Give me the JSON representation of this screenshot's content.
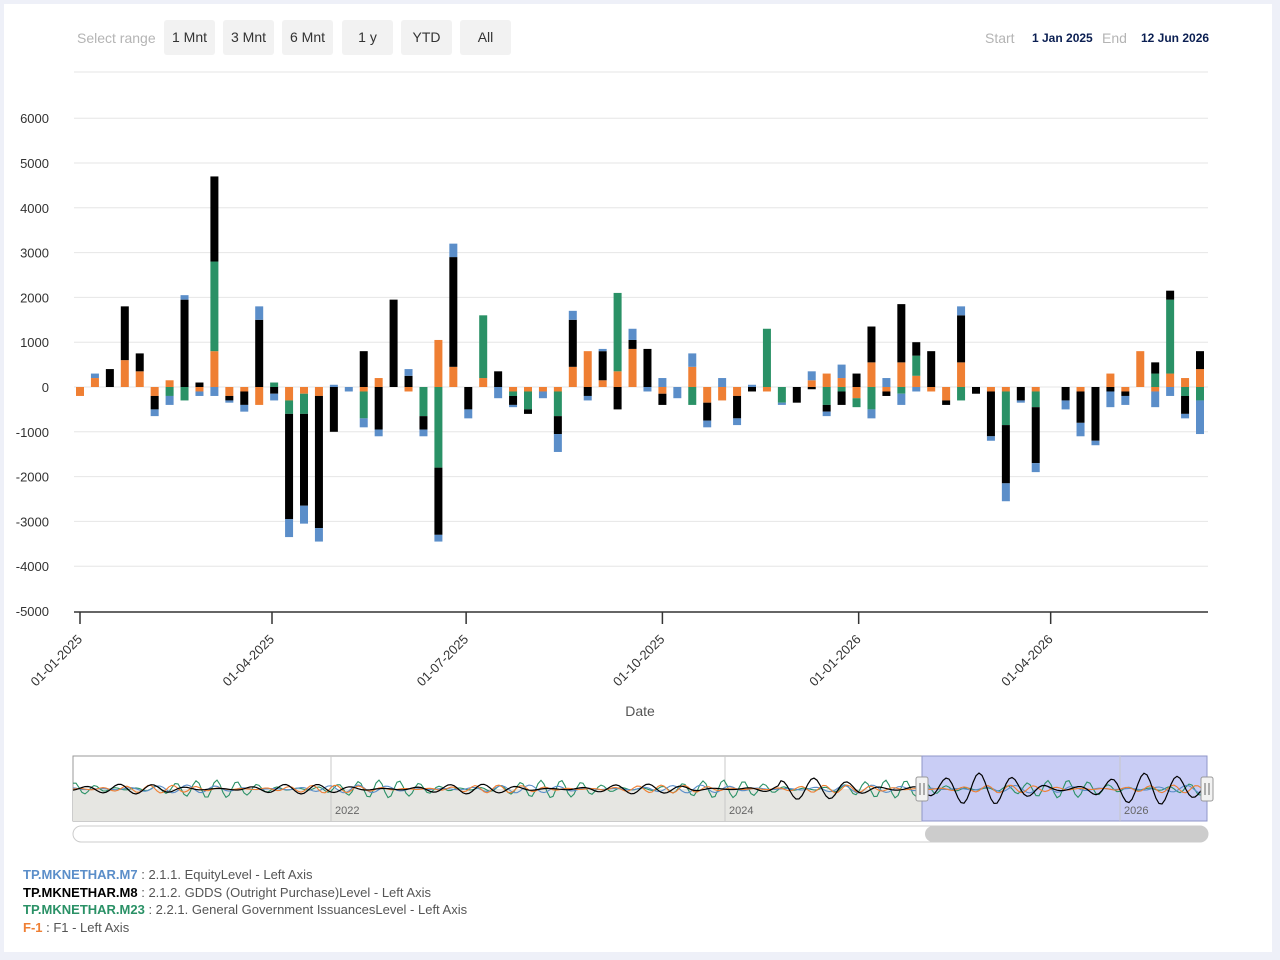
{
  "range_selector": {
    "label": "Select range",
    "buttons": [
      "1 Mnt",
      "3 Mnt",
      "6 Mnt",
      "1 y",
      "YTD",
      "All"
    ],
    "start_label": "Start",
    "start_value": "1 Jan 2025",
    "end_label": "End",
    "end_value": "12 Jun 2026"
  },
  "colors": {
    "m7": "#5b8ec9",
    "m8": "#000000",
    "m23": "#2a9166",
    "f1": "#ef7f33"
  },
  "legend": [
    {
      "code": "TP.MKNETHAR.M7",
      "desc": " : 2.1.1. EquityLevel - Left Axis",
      "color": "#5b8ec9"
    },
    {
      "code": "TP.MKNETHAR.M8",
      "desc": " : 2.1.2. GDDS (Outright Purchase)Level - Left Axis",
      "color": "#000000"
    },
    {
      "code": "TP.MKNETHAR.M23",
      "desc": " : 2.2.1. General Government IssuancesLevel - Left Axis",
      "color": "#2a9166"
    },
    {
      "code": "F-1",
      "desc": " : F1 - Left Axis",
      "color": "#ef7f33"
    }
  ],
  "navigator": {
    "labels": [
      "2022",
      "2024",
      "2026"
    ]
  },
  "chart_data": {
    "type": "bar",
    "stacked": true,
    "xlabel": "Date",
    "x_tick_labels": [
      "01-01-2025",
      "01-04-2025",
      "01-07-2025",
      "01-10-2025",
      "01-01-2026",
      "01-04-2026"
    ],
    "x_ticks": [
      "2025-01-01",
      "2025-04-01",
      "2025-07-01",
      "2025-10-01",
      "2026-01-01",
      "2026-04-01"
    ],
    "ylim": [
      -5000,
      6000
    ],
    "yticks": [
      -5000,
      -4000,
      -3000,
      -2000,
      -1000,
      0,
      1000,
      2000,
      3000,
      4000,
      5000,
      6000
    ],
    "grid": true,
    "series_order": [
      "F-1",
      "TP.MKNETHAR.M23",
      "TP.MKNETHAR.M8",
      "TP.MKNETHAR.M7"
    ],
    "x": [
      "2025-01-01",
      "2025-01-08",
      "2025-01-15",
      "2025-01-22",
      "2025-01-29",
      "2025-02-05",
      "2025-02-12",
      "2025-02-19",
      "2025-02-26",
      "2025-03-05",
      "2025-03-12",
      "2025-03-19",
      "2025-03-26",
      "2025-04-02",
      "2025-04-09",
      "2025-04-16",
      "2025-04-23",
      "2025-04-30",
      "2025-05-07",
      "2025-05-14",
      "2025-05-21",
      "2025-05-28",
      "2025-06-04",
      "2025-06-11",
      "2025-06-18",
      "2025-06-25",
      "2025-07-02",
      "2025-07-09",
      "2025-07-16",
      "2025-07-23",
      "2025-07-30",
      "2025-08-06",
      "2025-08-13",
      "2025-08-20",
      "2025-08-27",
      "2025-09-03",
      "2025-09-10",
      "2025-09-17",
      "2025-09-24",
      "2025-10-01",
      "2025-10-08",
      "2025-10-15",
      "2025-10-22",
      "2025-10-29",
      "2025-11-05",
      "2025-11-12",
      "2025-11-19",
      "2025-11-26",
      "2025-12-03",
      "2025-12-10",
      "2025-12-17",
      "2025-12-24",
      "2025-12-31",
      "2026-01-07",
      "2026-01-14",
      "2026-01-21",
      "2026-01-28",
      "2026-02-04",
      "2026-02-11",
      "2026-02-18",
      "2026-02-25",
      "2026-03-04",
      "2026-03-11",
      "2026-03-18",
      "2026-03-25",
      "2026-04-01",
      "2026-04-08",
      "2026-04-15",
      "2026-04-22",
      "2026-04-29",
      "2026-05-06",
      "2026-05-13",
      "2026-05-20",
      "2026-05-27",
      "2026-06-03",
      "2026-06-10"
    ],
    "series": [
      {
        "name": "F-1",
        "values": [
          -200,
          200,
          0,
          600,
          350,
          -200,
          150,
          0,
          -100,
          800,
          -200,
          -100,
          -400,
          0,
          -300,
          -150,
          -200,
          0,
          0,
          -100,
          200,
          0,
          -100,
          0,
          1050,
          450,
          0,
          200,
          0,
          -100,
          -100,
          -100,
          -100,
          450,
          800,
          150,
          350,
          850,
          0,
          -150,
          0,
          450,
          -350,
          -300,
          -200,
          0,
          -100,
          0,
          0,
          150,
          300,
          200,
          -250,
          550,
          -100,
          550,
          250,
          -100,
          -300,
          550,
          0,
          -100,
          -100,
          0,
          -100,
          0,
          0,
          -100,
          0,
          300,
          -100,
          800,
          -100,
          300,
          200,
          400
        ]
      },
      {
        "name": "TP.MKNETHAR.M23",
        "values": [
          0,
          0,
          0,
          0,
          0,
          0,
          -200,
          -300,
          0,
          2000,
          0,
          0,
          0,
          100,
          -300,
          -450,
          0,
          0,
          0,
          -600,
          0,
          0,
          0,
          -650,
          -1800,
          0,
          0,
          1400,
          0,
          -100,
          -400,
          0,
          -550,
          0,
          0,
          0,
          1750,
          0,
          0,
          0,
          0,
          -400,
          0,
          0,
          0,
          0,
          1300,
          -350,
          0,
          0,
          -400,
          -100,
          -200,
          -500,
          0,
          -150,
          450,
          0,
          0,
          -300,
          0,
          0,
          -750,
          0,
          -350,
          0,
          0,
          0,
          0,
          0,
          0,
          0,
          300,
          1650,
          -200,
          -300
        ]
      },
      {
        "name": "TP.MKNETHAR.M8",
        "values": [
          0,
          0,
          400,
          1200,
          400,
          -300,
          0,
          1950,
          100,
          1900,
          -100,
          -300,
          1500,
          -150,
          -2350,
          -2050,
          -2950,
          -1000,
          0,
          800,
          -950,
          1950,
          250,
          -300,
          -1500,
          2450,
          -500,
          0,
          350,
          -200,
          -100,
          0,
          -400,
          1050,
          -200,
          650,
          -500,
          200,
          850,
          -250,
          0,
          0,
          -400,
          0,
          -500,
          -100,
          0,
          0,
          -350,
          -50,
          -150,
          -300,
          300,
          800,
          -100,
          1300,
          300,
          800,
          -100,
          1050,
          -150,
          -1000,
          -1300,
          -300,
          -1250,
          0,
          -300,
          -700,
          -1200,
          -100,
          -100,
          0,
          250,
          200,
          -400,
          400
        ]
      },
      {
        "name": "TP.MKNETHAR.M7",
        "values": [
          0,
          100,
          0,
          0,
          0,
          -150,
          -200,
          100,
          -100,
          -200,
          -50,
          -150,
          300,
          -150,
          -400,
          -400,
          -300,
          50,
          -100,
          -200,
          -150,
          0,
          150,
          -150,
          -150,
          300,
          -200,
          0,
          -250,
          -50,
          0,
          -150,
          -400,
          200,
          -100,
          50,
          0,
          250,
          -100,
          200,
          -250,
          300,
          -150,
          200,
          -150,
          50,
          0,
          -50,
          0,
          200,
          -100,
          300,
          0,
          -200,
          200,
          -250,
          -100,
          0,
          0,
          200,
          0,
          -100,
          -400,
          -50,
          -200,
          0,
          -200,
          -300,
          -100,
          -350,
          -200,
          0,
          -350,
          -200,
          -100,
          -750
        ]
      }
    ]
  }
}
